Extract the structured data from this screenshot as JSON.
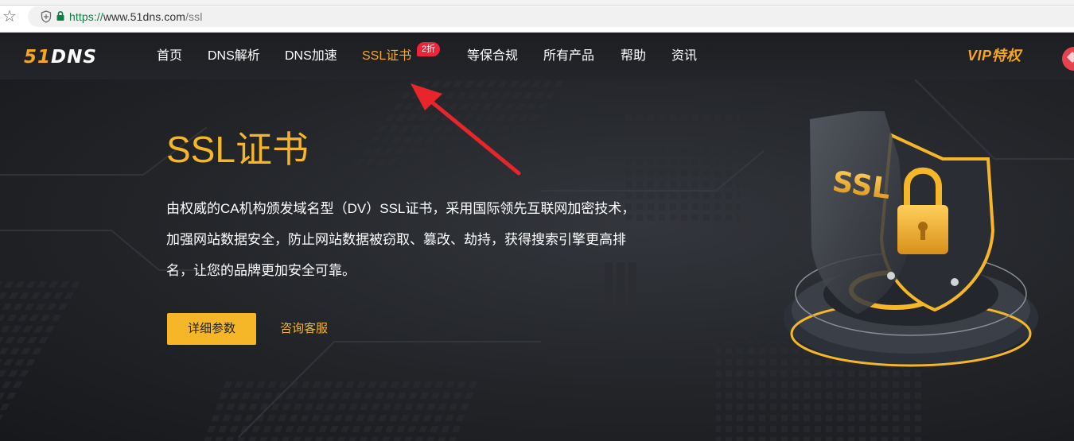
{
  "browser": {
    "url_scheme": "https://",
    "url_host": "www.51dns.com",
    "url_path": "/ssl"
  },
  "header": {
    "logo_num": "51",
    "logo_text": "DNS",
    "nav": [
      {
        "label": "首页"
      },
      {
        "label": "DNS解析"
      },
      {
        "label": "DNS加速"
      },
      {
        "label": "SSL证书",
        "active": true,
        "badge": "2折"
      },
      {
        "label": "等保合规"
      },
      {
        "label": "所有产品"
      },
      {
        "label": "帮助"
      },
      {
        "label": "资讯"
      }
    ],
    "vip_label": "VIP特权"
  },
  "hero": {
    "title": "SSL证书",
    "description": "由权威的CA机构颁发域名型（DV）SSL证书，采用国际领先互联网加密技术，加强网站数据安全，防止网站数据被窃取、篡改、劫持，获得搜索引擎更高排名，让您的品牌更加安全可靠。",
    "primary_button": "详细参数",
    "secondary_link": "咨询客服",
    "art_text": "SSL"
  },
  "colors": {
    "accent": "#f5b728",
    "badge": "#e9263c",
    "annotation": "#e8252a"
  }
}
